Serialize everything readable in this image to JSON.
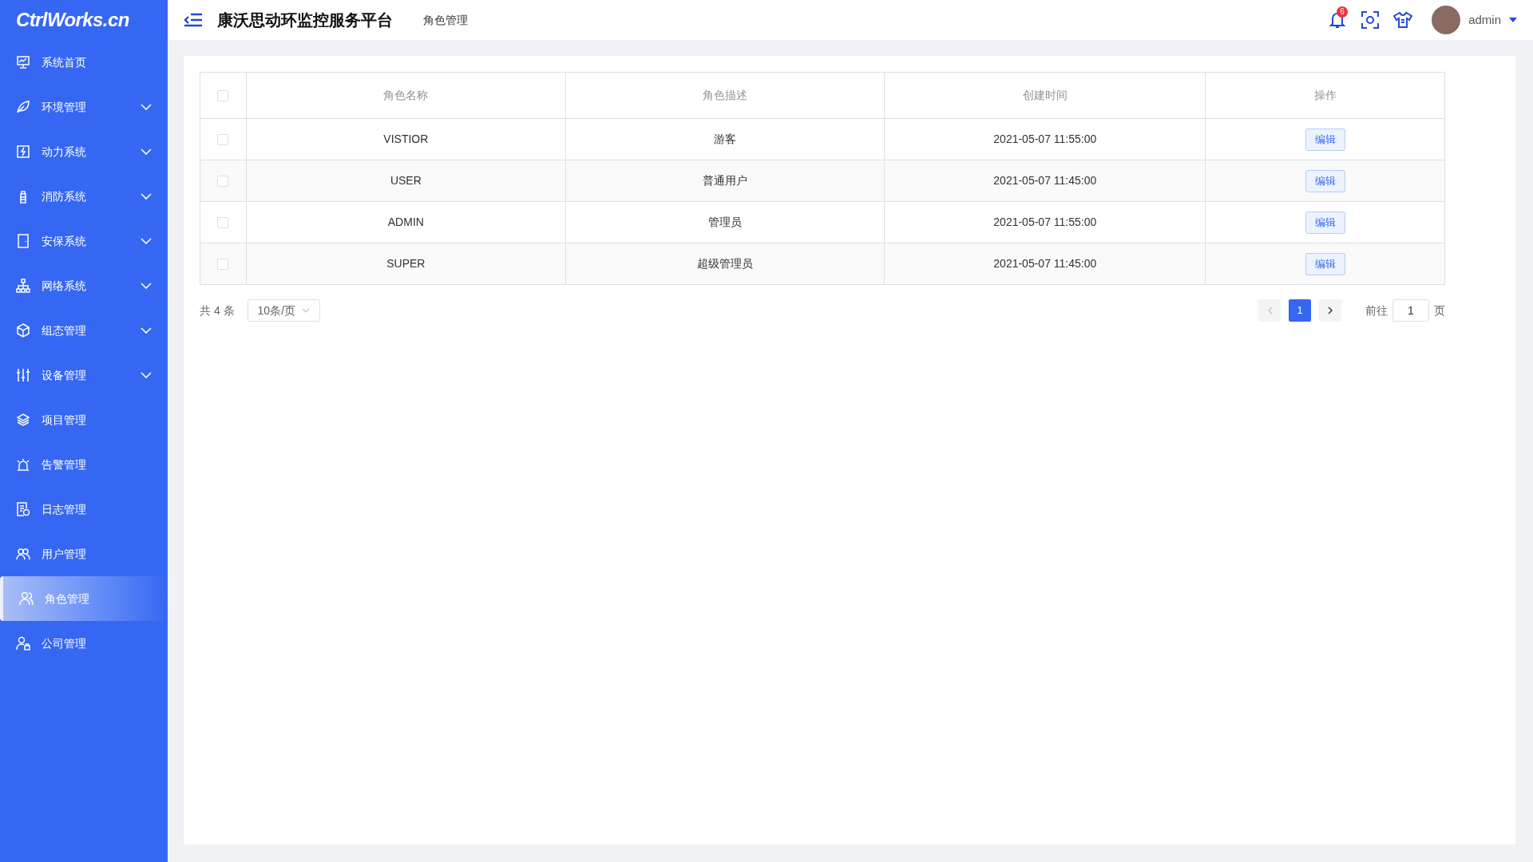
{
  "logo": "CtrlWorks.cn",
  "sidebar": {
    "items": [
      {
        "label": "系统首页",
        "kind": "link",
        "selected": false
      },
      {
        "label": "环境管理",
        "kind": "group",
        "expanded": false,
        "selected": false
      },
      {
        "label": "动力系统",
        "kind": "group",
        "expanded": false,
        "selected": false
      },
      {
        "label": "消防系统",
        "kind": "group",
        "expanded": false,
        "selected": false
      },
      {
        "label": "安保系统",
        "kind": "group",
        "expanded": false,
        "selected": false
      },
      {
        "label": "网络系统",
        "kind": "group",
        "expanded": false,
        "selected": false
      },
      {
        "label": "组态管理",
        "kind": "group",
        "expanded": false,
        "selected": false
      },
      {
        "label": "设备管理",
        "kind": "group",
        "expanded": false,
        "selected": false
      },
      {
        "label": "项目管理",
        "kind": "link",
        "selected": false
      },
      {
        "label": "告警管理",
        "kind": "link",
        "selected": false
      },
      {
        "label": "日志管理",
        "kind": "link",
        "selected": false
      },
      {
        "label": "用户管理",
        "kind": "link",
        "selected": false
      },
      {
        "label": "角色管理",
        "kind": "link",
        "selected": true
      },
      {
        "label": "公司管理",
        "kind": "link",
        "selected": false
      }
    ]
  },
  "header": {
    "title": "康沃思动环监控服务平台",
    "breadcrumb": "角色管理",
    "notification_count": "6",
    "user": "admin"
  },
  "table": {
    "select_all": false,
    "columns": [
      "角色名称",
      "角色描述",
      "创建时间",
      "操作"
    ],
    "rows": [
      {
        "checked": false,
        "name": "VISTIOR",
        "description": "游客",
        "created": "2021-05-07 11:55:00",
        "action": "编辑"
      },
      {
        "checked": false,
        "name": "USER",
        "description": "普通用户",
        "created": "2021-05-07 11:45:00",
        "action": "编辑"
      },
      {
        "checked": false,
        "name": "ADMIN",
        "description": "管理员",
        "created": "2021-05-07 11:55:00",
        "action": "编辑"
      },
      {
        "checked": false,
        "name": "SUPER",
        "description": "超级管理员",
        "created": "2021-05-07 11:45:00",
        "action": "编辑"
      }
    ]
  },
  "pagination": {
    "total": "共 4 条",
    "page_size": "10条/页",
    "prev_disabled": true,
    "next_disabled": false,
    "pages": [
      {
        "label": "1",
        "selected": true
      }
    ],
    "goto_label": "前往",
    "goto_value": "1",
    "goto_suffix": "页"
  }
}
